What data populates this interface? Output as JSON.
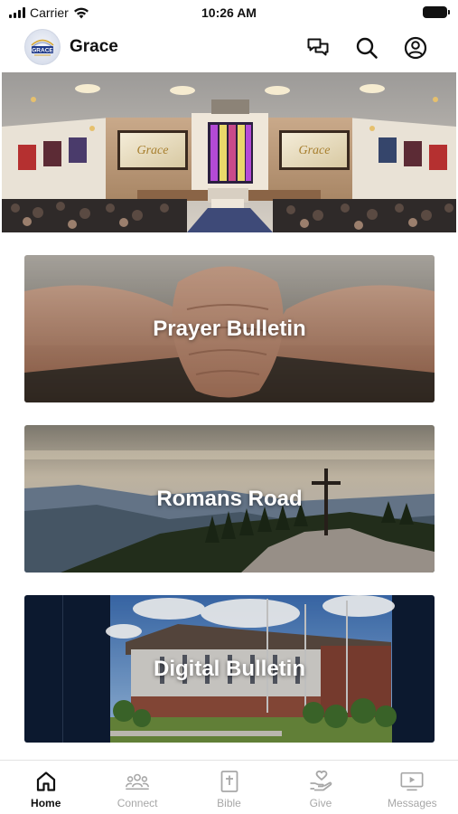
{
  "status_bar": {
    "carrier": "Carrier",
    "time": "10:26 AM"
  },
  "header": {
    "title": "Grace",
    "logo_text": "GRACE",
    "icons": [
      "chat-bubbles-icon",
      "search-icon",
      "account-icon"
    ]
  },
  "hero": {
    "screen_left_text": "Grace",
    "screen_right_text": "Grace"
  },
  "cards": [
    {
      "label": "Prayer Bulletin"
    },
    {
      "label": "Romans Road"
    },
    {
      "label": "Digital Bulletin"
    }
  ],
  "tabs": [
    {
      "label": "Home",
      "icon": "home-icon",
      "active": true
    },
    {
      "label": "Connect",
      "icon": "people-icon",
      "active": false
    },
    {
      "label": "Bible",
      "icon": "bible-icon",
      "active": false
    },
    {
      "label": "Give",
      "icon": "give-icon",
      "active": false
    },
    {
      "label": "Messages",
      "icon": "video-icon",
      "active": false
    }
  ],
  "colors": {
    "active_tab": "#111111",
    "inactive_tab": "#a7a7a7",
    "card_text": "#ffffff"
  }
}
